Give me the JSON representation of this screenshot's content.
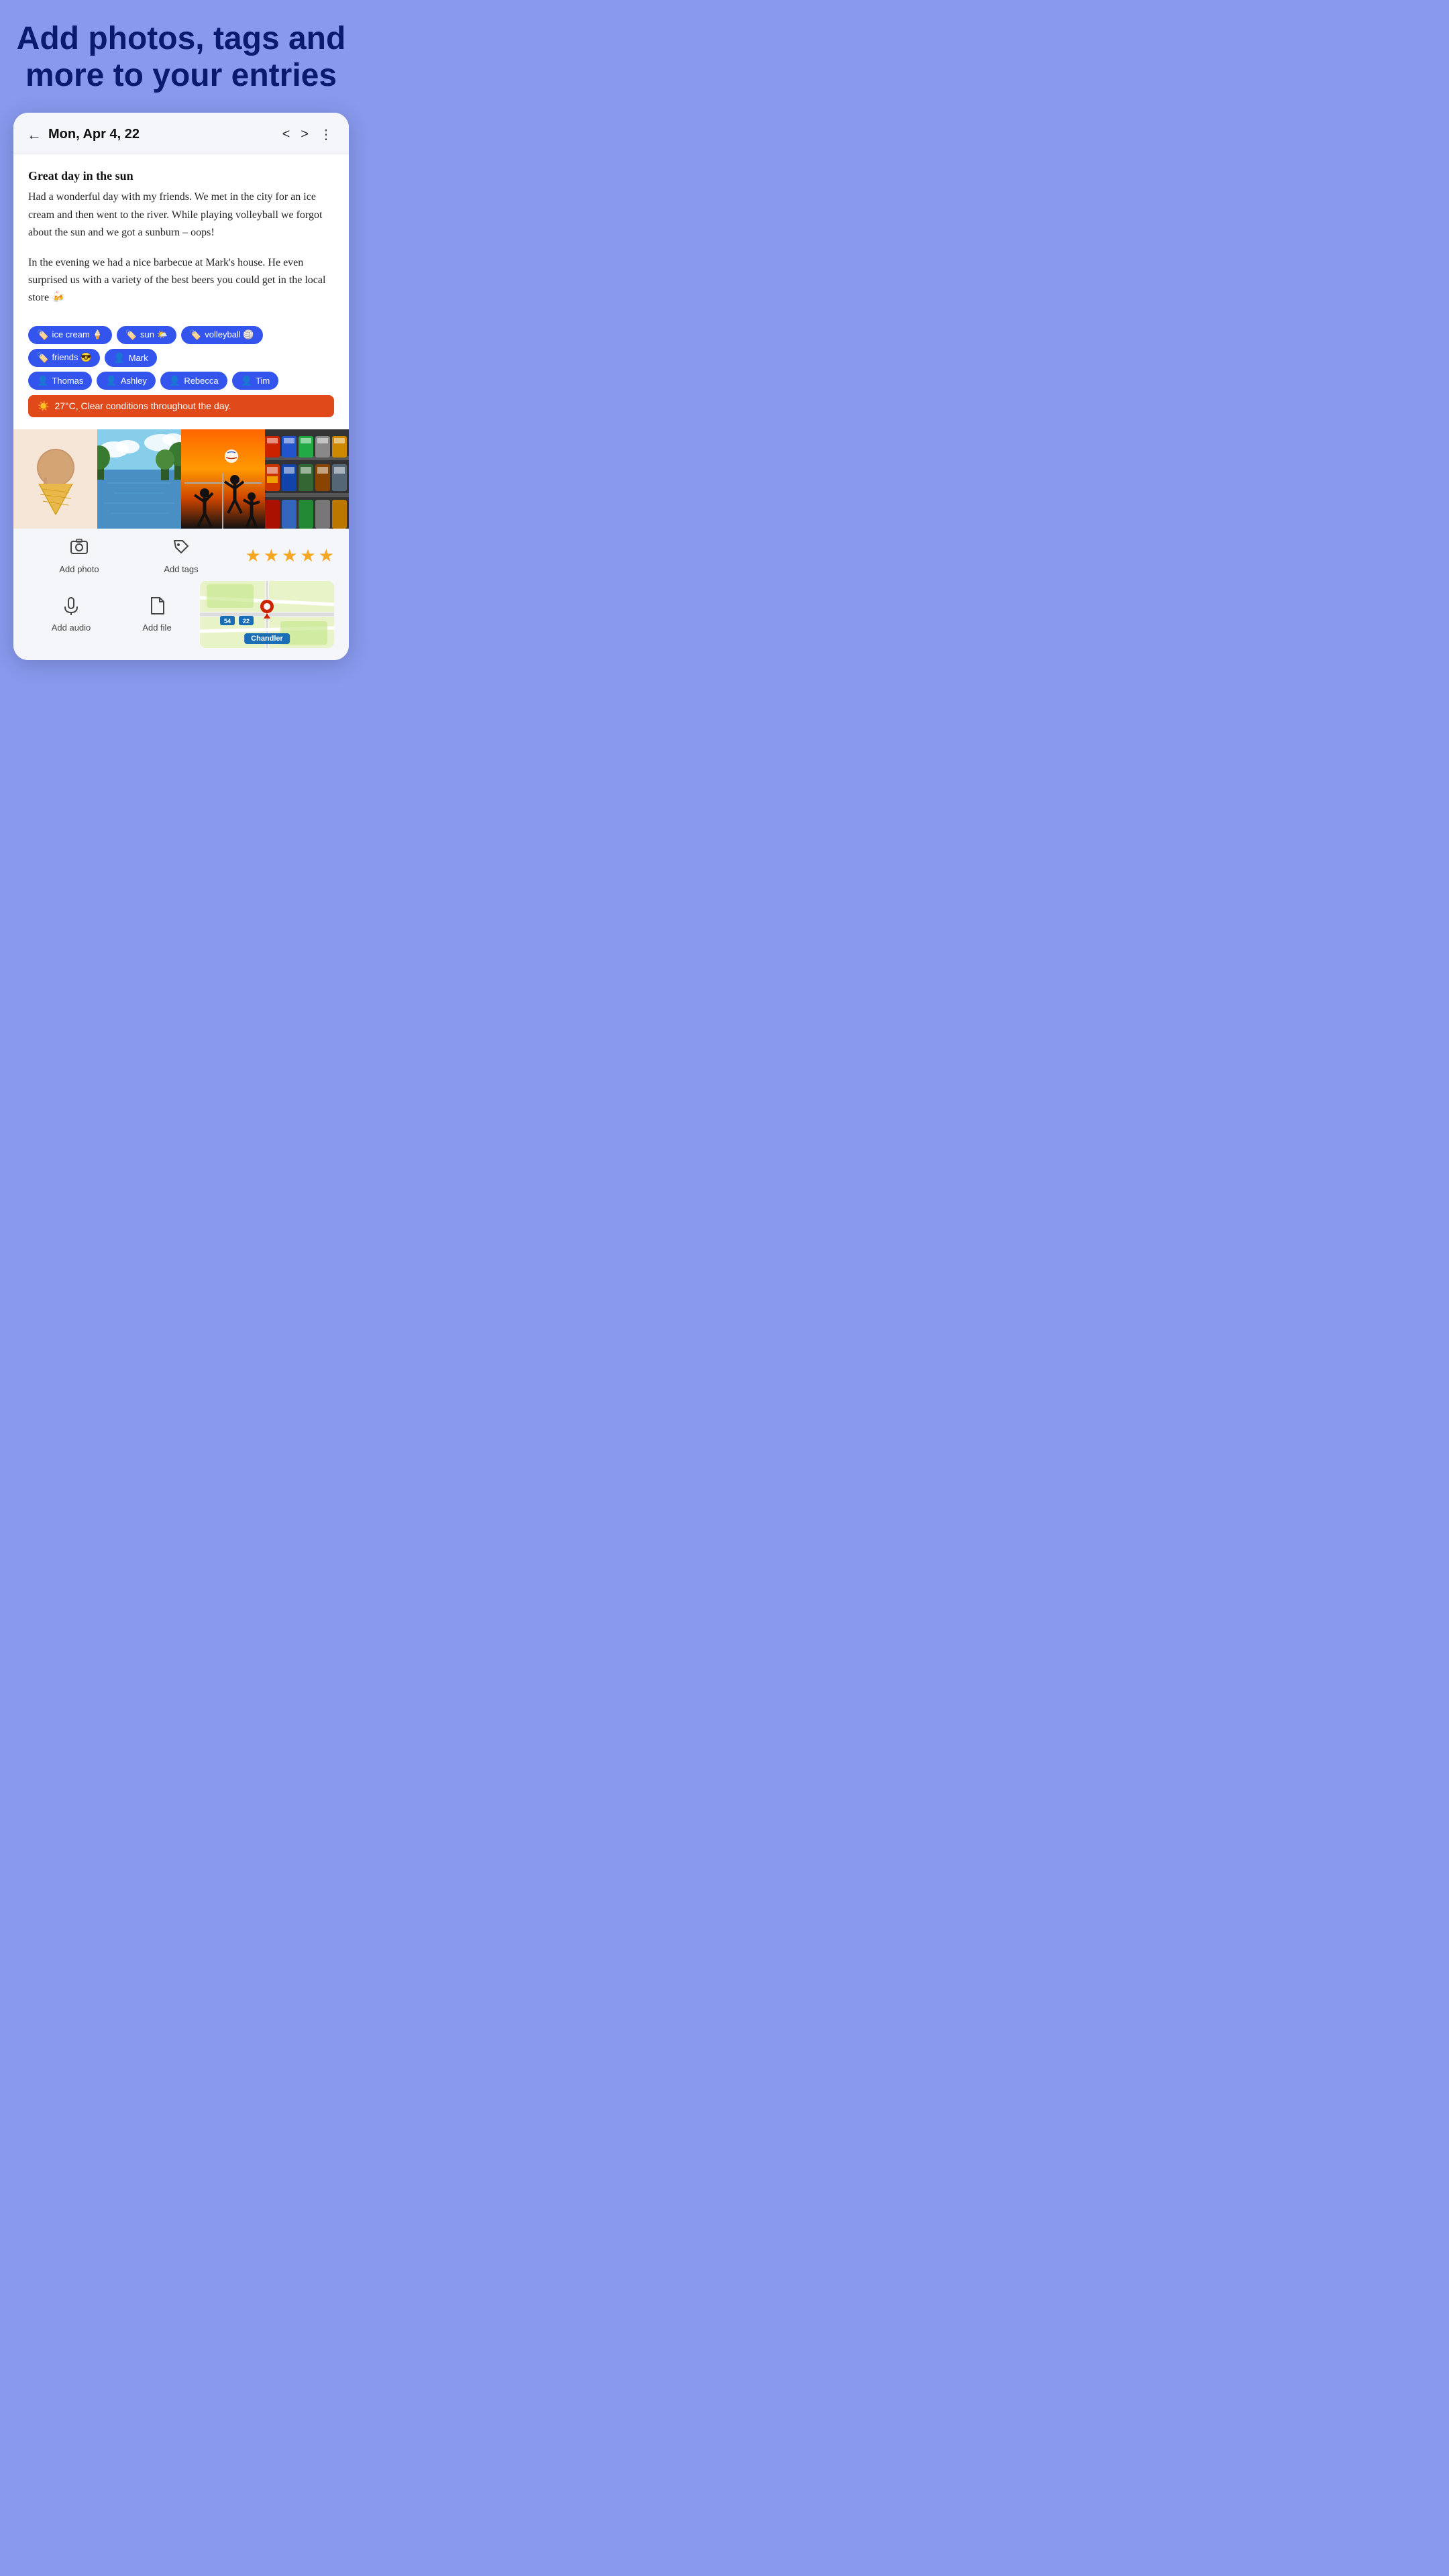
{
  "hero": {
    "title": "Add photos, tags and more to your entries"
  },
  "header": {
    "back_icon": "←",
    "date": "Mon, Apr 4, 22",
    "prev_icon": "<",
    "next_icon": ">",
    "more_icon": "⋮"
  },
  "entry": {
    "title": "Great day in the sun",
    "paragraph1": "Had a wonderful day with my friends. We met in the city for an ice cream and then went to the river. While playing volleyball we forgot about the sun and we got a sunburn – oops!",
    "paragraph2": "In the evening we had a nice barbecue at Mark's house. He even surprised us with a variety of the best beers you could get in the local store 🍻"
  },
  "tags": {
    "row1": [
      {
        "label": "ice cream 🍦",
        "type": "tag"
      },
      {
        "label": "sun 🌤️",
        "type": "tag"
      },
      {
        "label": "volleyball 🏐",
        "type": "tag"
      },
      {
        "label": "friends 😎",
        "type": "tag"
      },
      {
        "label": "Mark",
        "type": "person"
      }
    ],
    "row2": [
      {
        "label": "Thomas",
        "type": "person"
      },
      {
        "label": "Ashley",
        "type": "person"
      },
      {
        "label": "Rebecca",
        "type": "person"
      },
      {
        "label": "Tim",
        "type": "person"
      }
    ]
  },
  "weather": {
    "icon": "☀️",
    "text": "27°C, Clear conditions throughout the day."
  },
  "photos": [
    {
      "label": "ice cream",
      "emoji": "🍦"
    },
    {
      "label": "river",
      "emoji": "🌊"
    },
    {
      "label": "volleyball",
      "emoji": "🏐"
    },
    {
      "label": "beers",
      "emoji": "🍺"
    }
  ],
  "actions": {
    "add_photo_label": "Add photo",
    "add_tags_label": "Add tags",
    "add_audio_label": "Add audio",
    "add_file_label": "Add file",
    "stars": 5
  },
  "map": {
    "location_label": "Chandler"
  }
}
